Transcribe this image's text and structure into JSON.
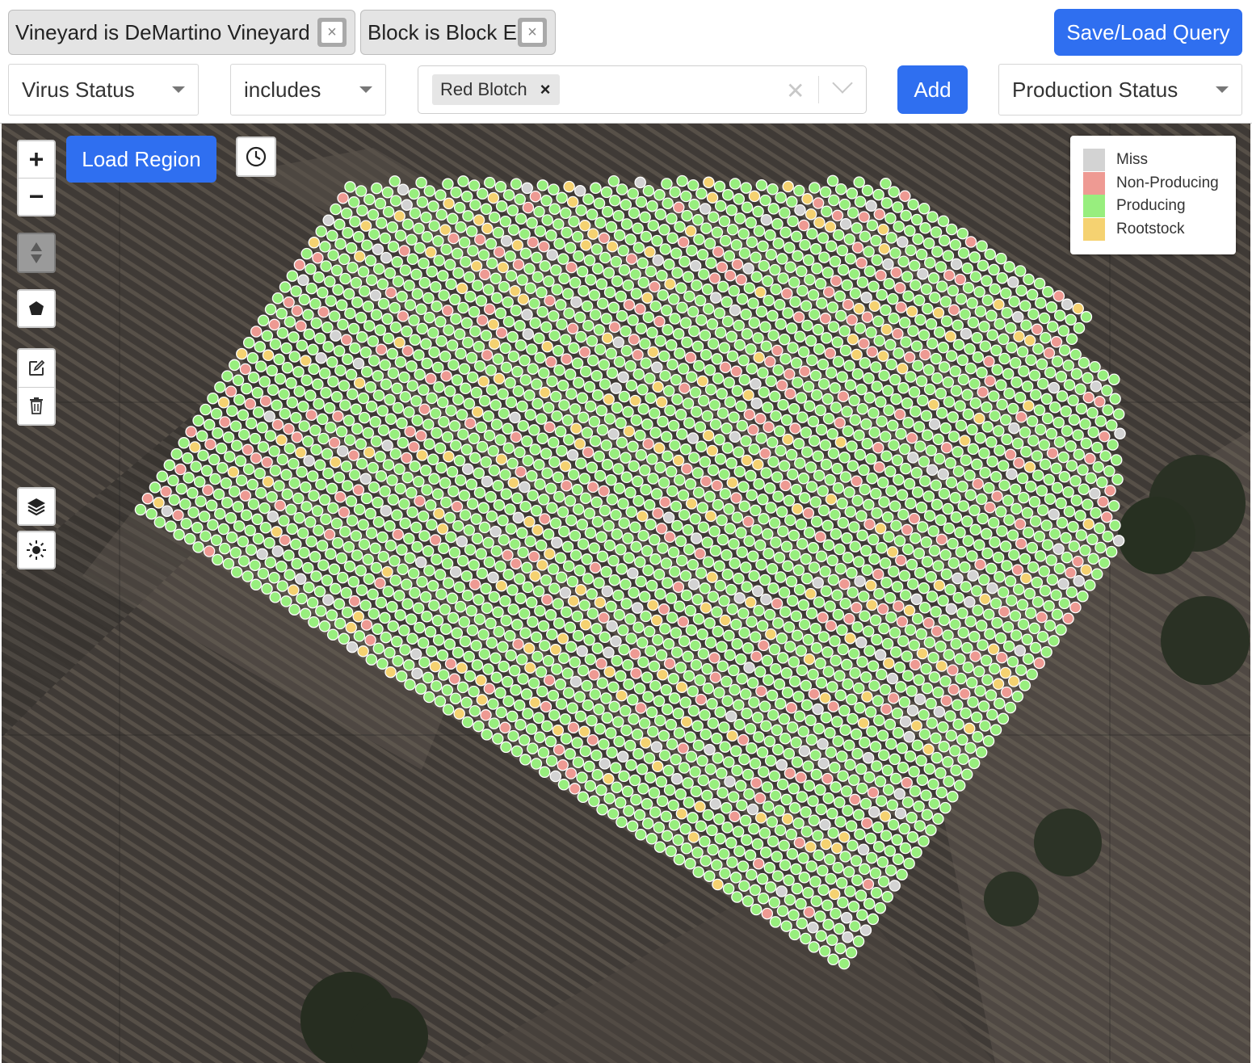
{
  "filters": {
    "chips": [
      {
        "label": "Vineyard is DeMartino Vineyard",
        "remove": "×"
      },
      {
        "label": "Block is Block E",
        "remove": "×"
      }
    ],
    "save_load_label": "Save/Load Query",
    "attribute_select": "Virus Status",
    "operator_select": "includes",
    "value_tags": [
      {
        "label": "Red Blotch",
        "remove": "×"
      }
    ],
    "clear_symbol": "✕",
    "add_label": "Add",
    "color_by_select": "Production Status"
  },
  "map": {
    "zoom_in": "+",
    "zoom_out": "−",
    "load_region_label": "Load Region",
    "block_outline_angle_deg": 33,
    "dot_colors": {
      "Miss": "#d3d3d3",
      "Non-Producing": "#ee9a93",
      "Producing": "#98ee7e",
      "Rootstock": "#f5d271"
    },
    "dot_share": {
      "Producing": 0.8,
      "Non-Producing": 0.09,
      "Miss": 0.05,
      "Rootstock": 0.06
    }
  },
  "legend": {
    "items": [
      {
        "label": "Miss",
        "color": "#d3d3d3"
      },
      {
        "label": "Non-Producing",
        "color": "#ee9a93"
      },
      {
        "label": "Producing",
        "color": "#98ee7e"
      },
      {
        "label": "Rootstock",
        "color": "#f5d271"
      }
    ]
  },
  "icons": [
    "close-icon",
    "chevron-down-icon",
    "clock-icon",
    "elevation-arrows-icon",
    "polygon-icon",
    "edit-icon",
    "trash-icon",
    "layers-icon",
    "brightness-icon"
  ]
}
